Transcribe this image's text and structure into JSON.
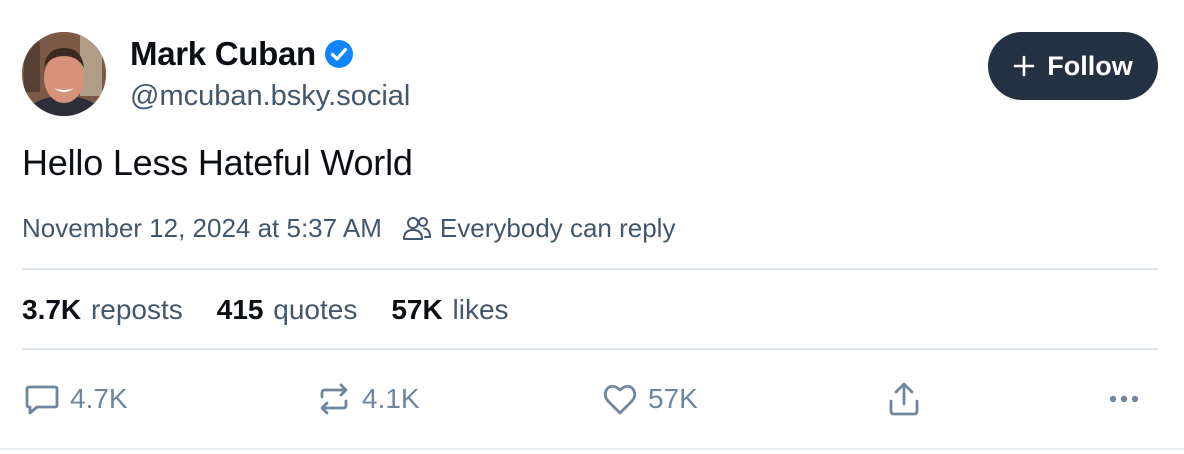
{
  "post": {
    "author": {
      "display_name": "Mark Cuban",
      "handle": "@mcuban.bsky.social",
      "verified": true
    },
    "follow_button": {
      "label": "Follow",
      "icon": "plus-icon"
    },
    "text": "Hello Less Hateful World",
    "timestamp": "November 12, 2024 at 5:37 AM",
    "reply_setting": {
      "label": "Everybody can reply",
      "icon": "people-icon"
    },
    "stats": {
      "reposts": {
        "count": "3.7K",
        "label": "reposts"
      },
      "quotes": {
        "count": "415",
        "label": "quotes"
      },
      "likes": {
        "count": "57K",
        "label": "likes"
      }
    },
    "actions": {
      "reply": {
        "icon": "comment-icon",
        "count": "4.7K"
      },
      "repost": {
        "icon": "repost-icon",
        "count": "4.1K"
      },
      "like": {
        "icon": "heart-icon",
        "count": "57K"
      },
      "share": {
        "icon": "share-icon"
      },
      "more": {
        "icon": "more-options-icon"
      }
    }
  },
  "colors": {
    "text_primary": "#0b0f14",
    "text_secondary": "#42576c",
    "icon_muted": "#6f869f",
    "verified_blue": "#1083fe",
    "follow_button_bg": "#243142",
    "divider": "#dfe5ec"
  }
}
